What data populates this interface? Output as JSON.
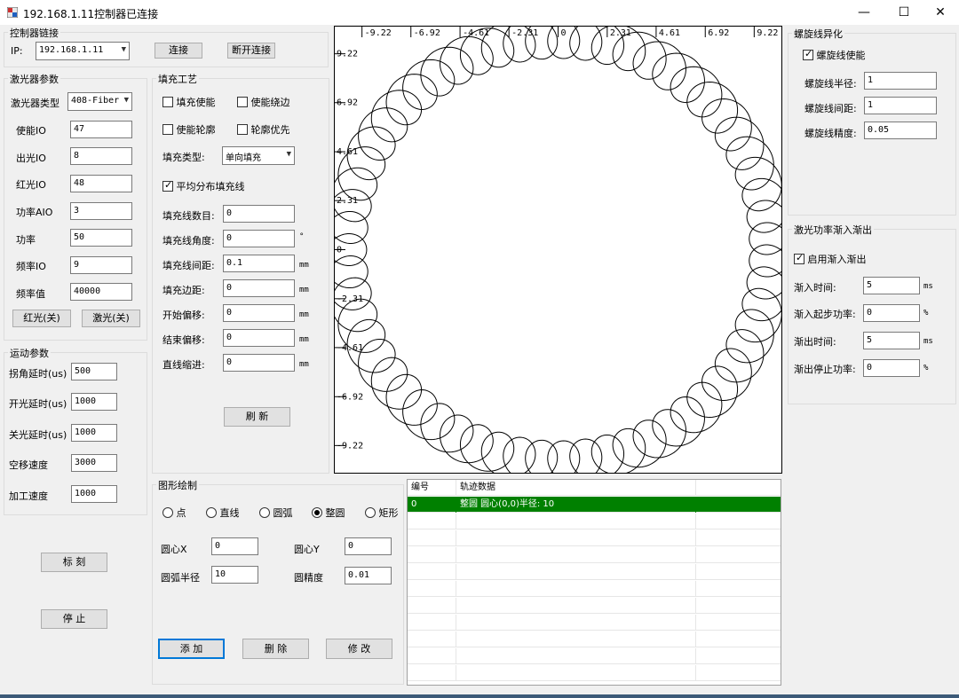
{
  "window": {
    "title": "192.168.1.11控制器已连接",
    "minimize_glyph": "—",
    "maximize_glyph": "☐",
    "close_glyph": "✕"
  },
  "controller": {
    "group_title": "控制器链接",
    "ip_label": "IP:",
    "ip_value": "192.168.1.11",
    "connect_label": "连接",
    "disconnect_label": "断开连接"
  },
  "laser": {
    "group_title": "激光器参数",
    "type_label": "激光器类型",
    "type_value": "408-Fiber",
    "fields": [
      {
        "label": "使能IO",
        "value": "47"
      },
      {
        "label": "出光IO",
        "value": "8"
      },
      {
        "label": "红光IO",
        "value": "48"
      },
      {
        "label": "功率AIO",
        "value": "3"
      },
      {
        "label": "功率",
        "value": "50"
      },
      {
        "label": "频率IO",
        "value": "9"
      },
      {
        "label": "频率值",
        "value": "40000"
      }
    ],
    "red_light_label": "红光(关)",
    "laser_light_label": "激光(关)"
  },
  "motion": {
    "group_title": "运动参数",
    "fields": [
      {
        "label": "拐角延时(us)",
        "value": "500"
      },
      {
        "label": "开光延时(us)",
        "value": "1000"
      },
      {
        "label": "关光延时(us)",
        "value": "1000"
      },
      {
        "label": "空移速度",
        "value": "3000"
      },
      {
        "label": "加工速度",
        "value": "1000"
      }
    ],
    "mark_label": "标 刻",
    "stop_label": "停 止"
  },
  "fill": {
    "group_title": "填充工艺",
    "checks": [
      {
        "label": "填充使能",
        "checked": false
      },
      {
        "label": "使能绕边",
        "checked": false
      },
      {
        "label": "使能轮廓",
        "checked": false
      },
      {
        "label": "轮廓优先",
        "checked": false
      }
    ],
    "type_label": "填充类型:",
    "type_value": "单向填充",
    "even_label": "平均分布填充线",
    "even_checked": true,
    "fields": [
      {
        "label": "填充线数目:",
        "value": "0",
        "unit": ""
      },
      {
        "label": "填充线角度:",
        "value": "0",
        "unit": "°"
      },
      {
        "label": "填充线间距:",
        "value": "0.1",
        "unit": "mm"
      },
      {
        "label": "填充边距:",
        "value": "0",
        "unit": "mm"
      },
      {
        "label": "开始偏移:",
        "value": "0",
        "unit": "mm"
      },
      {
        "label": "结束偏移:",
        "value": "0",
        "unit": "mm"
      },
      {
        "label": "直线缩进:",
        "value": "0",
        "unit": "mm"
      }
    ],
    "refresh_label": "刷 新"
  },
  "canvas": {
    "top_ticks": [
      "-9.22",
      "-6.92",
      "-4.61",
      "-2.31",
      "0",
      "2.31",
      "4.61",
      "6.92",
      "9.22"
    ],
    "left_ticks": [
      "9.22",
      "6.92",
      "4.61",
      "2.31",
      "0",
      "-2.31",
      "-4.61",
      "-6.92",
      "-9.22"
    ],
    "spiral": {
      "circle_radius": 10,
      "spiral_radius": 1,
      "loops": 60,
      "range": 10.5
    }
  },
  "spiral": {
    "group_title": "螺旋线异化",
    "enable_label": "螺旋线使能",
    "enable_checked": true,
    "fields": [
      {
        "label": "螺旋线半径:",
        "value": "1"
      },
      {
        "label": "螺旋线间距:",
        "value": "1"
      },
      {
        "label": "螺旋线精度:",
        "value": "0.05"
      }
    ]
  },
  "ramp": {
    "group_title": "激光功率渐入渐出",
    "enable_label": "启用渐入渐出",
    "enable_checked": true,
    "fields": [
      {
        "label": "渐入时间:",
        "value": "5",
        "unit": "ms"
      },
      {
        "label": "渐入起步功率:",
        "value": "0",
        "unit": "%"
      },
      {
        "label": "渐出时间:",
        "value": "5",
        "unit": "ms"
      },
      {
        "label": "渐出停止功率:",
        "value": "0",
        "unit": "%"
      }
    ]
  },
  "shape": {
    "group_title": "图形绘制",
    "radios": [
      {
        "label": "点",
        "checked": false
      },
      {
        "label": "直线",
        "checked": false
      },
      {
        "label": "圆弧",
        "checked": false
      },
      {
        "label": "整圆",
        "checked": true
      },
      {
        "label": "矩形",
        "checked": false
      }
    ],
    "center_x_label": "圆心X",
    "center_x_value": "0",
    "center_y_label": "圆心Y",
    "center_y_value": "0",
    "radius_label": "圆弧半径",
    "radius_value": "10",
    "precision_label": "圆精度",
    "precision_value": "0.01",
    "add_label": "添 加",
    "delete_label": "删 除",
    "modify_label": "修 改"
  },
  "track_table": {
    "columns": [
      "编号",
      "轨迹数据"
    ],
    "rows": [
      [
        "0",
        "整圆 圆心(0,0)半径: 10"
      ]
    ],
    "selected_row": 0,
    "highlight_color": "#008000"
  }
}
